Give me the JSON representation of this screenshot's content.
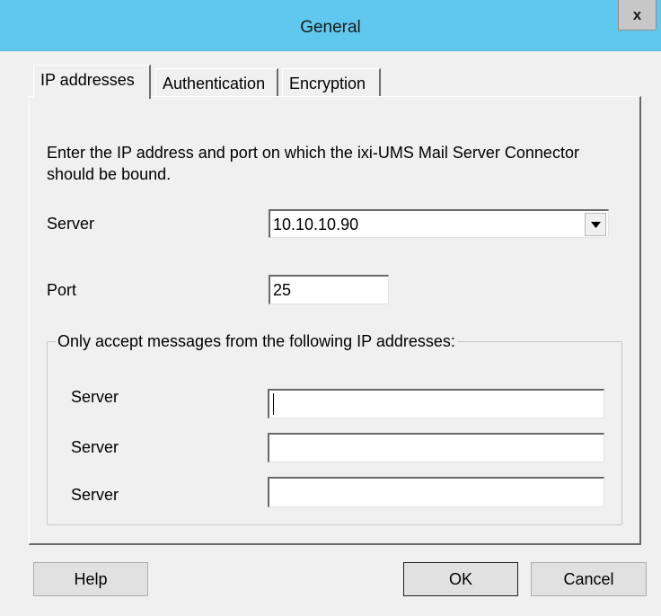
{
  "window": {
    "title": "General",
    "close_symbol": "x"
  },
  "tabs": [
    {
      "label": "IP addresses",
      "active": true
    },
    {
      "label": "Authentication",
      "active": false
    },
    {
      "label": "Encryption",
      "active": false
    }
  ],
  "ip_tab": {
    "description": "Enter the IP address and port on which the ixi-UMS Mail Server Connector should be bound.",
    "server_label": "Server",
    "server_value": "10.10.10.90",
    "port_label": "Port",
    "port_value": "25",
    "group_title": "Only accept messages from the following IP addresses:",
    "accept_servers": [
      {
        "label": "Server",
        "value": ""
      },
      {
        "label": "Server",
        "value": ""
      },
      {
        "label": "Server",
        "value": ""
      }
    ]
  },
  "buttons": {
    "help": "Help",
    "ok": "OK",
    "cancel": "Cancel"
  },
  "colors": {
    "title_bar": "#60c8ee",
    "dialog_bg": "#f0f0f0"
  }
}
